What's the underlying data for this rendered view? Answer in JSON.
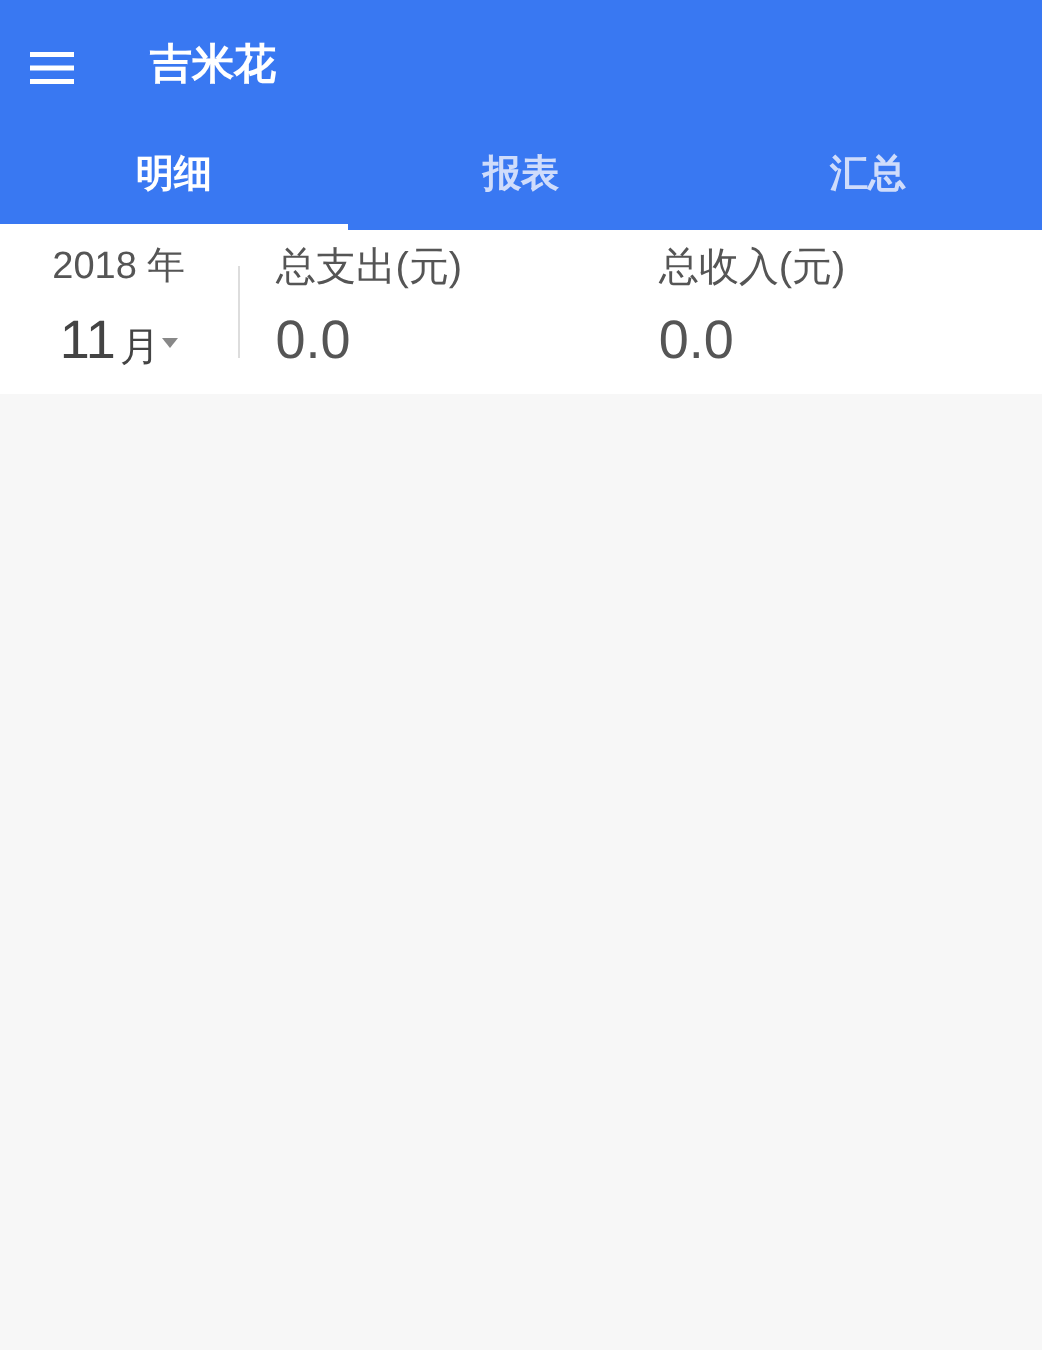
{
  "app_bar": {
    "title": "吉米花"
  },
  "tabs": [
    {
      "label": "明细",
      "selected": true
    },
    {
      "label": "报表",
      "selected": false
    },
    {
      "label": "汇总",
      "selected": false
    }
  ],
  "period": {
    "year": "2018 年",
    "month": "11",
    "month_unit": "月"
  },
  "totals": [
    {
      "label": "总支出(元)",
      "value": "0.0"
    },
    {
      "label": "总收入(元)",
      "value": "0.0"
    }
  ]
}
